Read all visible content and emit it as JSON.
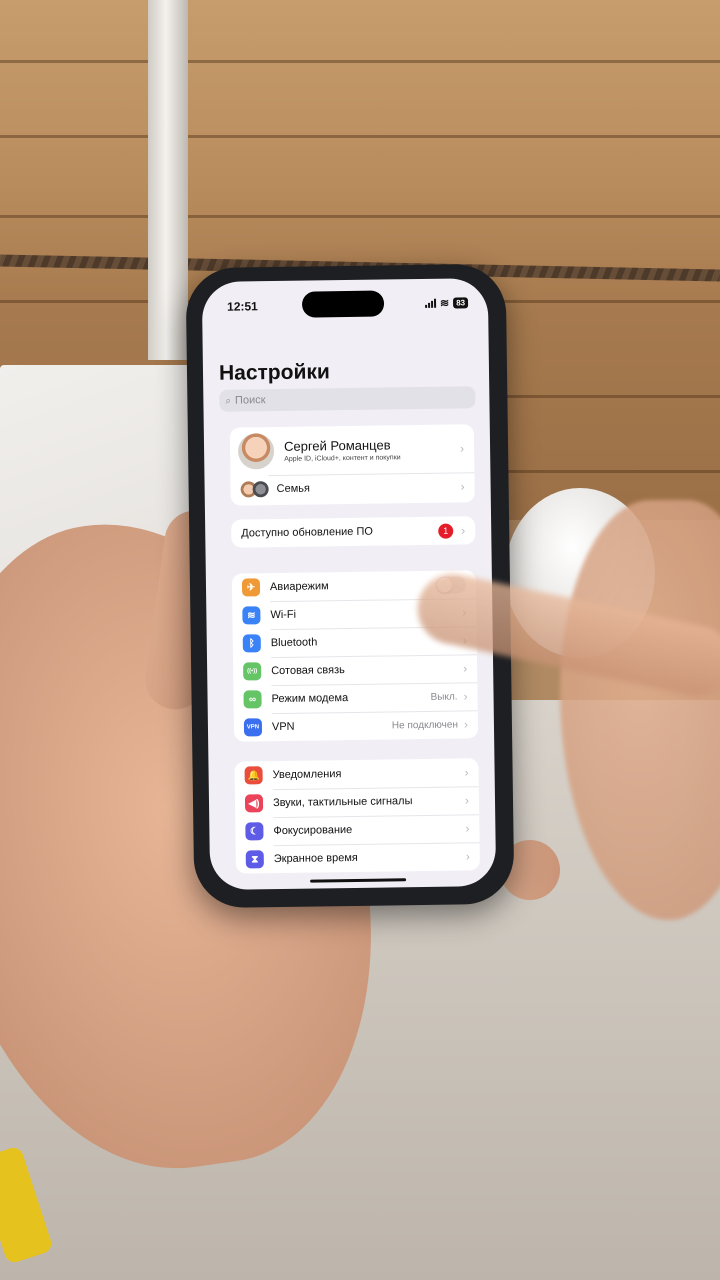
{
  "status": {
    "time": "12:51",
    "battery": "83"
  },
  "header": {
    "title": "Настройки"
  },
  "search": {
    "placeholder": "Поиск"
  },
  "profile": {
    "name": "Сергей Романцев",
    "subtitle": "Apple ID, iCloud+, контент и покупки",
    "family_label": "Семья"
  },
  "update": {
    "label": "Доступно обновление ПО",
    "badge": "1"
  },
  "connectivity": [
    {
      "label": "Авиарежим",
      "icon": "airplane-icon",
      "color": "#f09a37",
      "value": "",
      "control": "toggle"
    },
    {
      "label": "Wi-Fi",
      "icon": "wifi-icon",
      "color": "#3a82f7",
      "value": "",
      "control": "chevron"
    },
    {
      "label": "Bluetooth",
      "icon": "bluetooth-icon",
      "color": "#3a82f7",
      "value": "",
      "control": "chevron"
    },
    {
      "label": "Сотовая связь",
      "icon": "cellular-icon",
      "color": "#65c466",
      "value": "",
      "control": "chevron"
    },
    {
      "label": "Режим модема",
      "icon": "hotspot-icon",
      "color": "#65c466",
      "value": "Выкл.",
      "control": "chevron"
    },
    {
      "label": "VPN",
      "icon": "vpn-icon",
      "color": "#3a6ff0",
      "value": "Не подключен",
      "control": "chevron"
    }
  ],
  "general": [
    {
      "label": "Уведомления",
      "icon": "bell-icon",
      "color": "#eb4d3d"
    },
    {
      "label": "Звуки, тактильные сигналы",
      "icon": "speaker-icon",
      "color": "#eb445a"
    },
    {
      "label": "Фокусирование",
      "icon": "moon-icon",
      "color": "#5e5ce6"
    },
    {
      "label": "Экранное время",
      "icon": "hourglass-icon",
      "color": "#5e5ce6"
    }
  ],
  "icon_glyphs": {
    "airplane-icon": "✈",
    "wifi-icon": "≋",
    "bluetooth-icon": "ᛒ",
    "cellular-icon": "((•))",
    "hotspot-icon": "∞",
    "vpn-icon": "VPN",
    "bell-icon": "🔔",
    "speaker-icon": "◀)",
    "moon-icon": "☾",
    "hourglass-icon": "⧗"
  }
}
